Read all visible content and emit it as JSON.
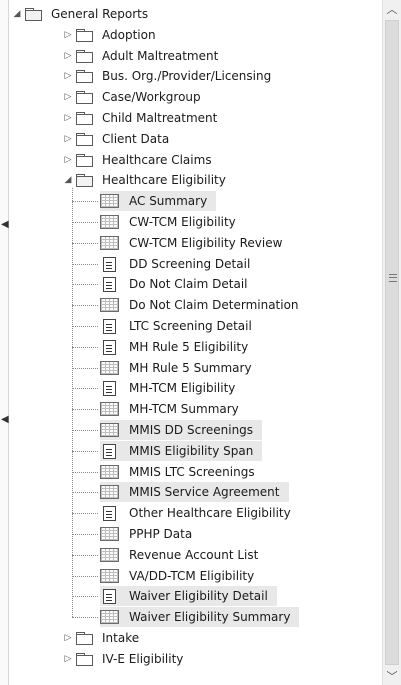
{
  "tree": {
    "root": "General Reports",
    "folders_before": [
      "Adoption",
      "Adult Maltreatment",
      "Bus. Org./Provider/Licensing",
      "Case/Workgroup",
      "Child Maltreatment",
      "Client Data",
      "Healthcare Claims"
    ],
    "expanded_folder": "Healthcare Eligibility",
    "reports": [
      {
        "label": "AC Summary",
        "icon": "report-grid-icon",
        "selected": true
      },
      {
        "label": "CW-TCM Eligibility",
        "icon": "report-grid-icon",
        "selected": false
      },
      {
        "label": "CW-TCM Eligibility Review",
        "icon": "report-grid-icon",
        "selected": false
      },
      {
        "label": "DD Screening Detail",
        "icon": "document-icon",
        "selected": false
      },
      {
        "label": "Do Not Claim Detail",
        "icon": "document-icon",
        "selected": false
      },
      {
        "label": "Do Not Claim Determination",
        "icon": "report-grid-icon",
        "selected": false
      },
      {
        "label": "LTC Screening Detail",
        "icon": "document-icon",
        "selected": false
      },
      {
        "label": "MH Rule 5 Eligibility",
        "icon": "document-icon",
        "selected": false
      },
      {
        "label": "MH Rule 5 Summary",
        "icon": "report-grid-icon",
        "selected": false
      },
      {
        "label": "MH-TCM Eligibility",
        "icon": "document-icon",
        "selected": false
      },
      {
        "label": "MH-TCM Summary",
        "icon": "report-grid-icon",
        "selected": false
      },
      {
        "label": "MMIS DD Screenings",
        "icon": "report-grid-icon",
        "selected": true
      },
      {
        "label": "MMIS Eligibility Span",
        "icon": "document-icon",
        "selected": true
      },
      {
        "label": "MMIS LTC Screenings",
        "icon": "report-grid-icon",
        "selected": false
      },
      {
        "label": "MMIS Service Agreement",
        "icon": "report-grid-icon",
        "selected": true
      },
      {
        "label": "Other Healthcare Eligibility",
        "icon": "document-icon",
        "selected": false
      },
      {
        "label": "PPHP Data",
        "icon": "report-grid-icon",
        "selected": false
      },
      {
        "label": "Revenue Account List",
        "icon": "report-grid-icon",
        "selected": false
      },
      {
        "label": "VA/DD-TCM Eligibility",
        "icon": "report-grid-icon",
        "selected": false
      },
      {
        "label": "Waiver Eligibility Detail",
        "icon": "document-icon",
        "selected": true
      },
      {
        "label": "Waiver Eligibility Summary",
        "icon": "report-grid-icon",
        "selected": true
      }
    ],
    "folders_after": [
      "Intake",
      "IV-E Eligibility"
    ]
  },
  "glyphs": {
    "expanded": "◢",
    "collapsed": "▷",
    "scroll_up": "︿",
    "scroll_down": "﹀",
    "splitter_left": "◀"
  }
}
